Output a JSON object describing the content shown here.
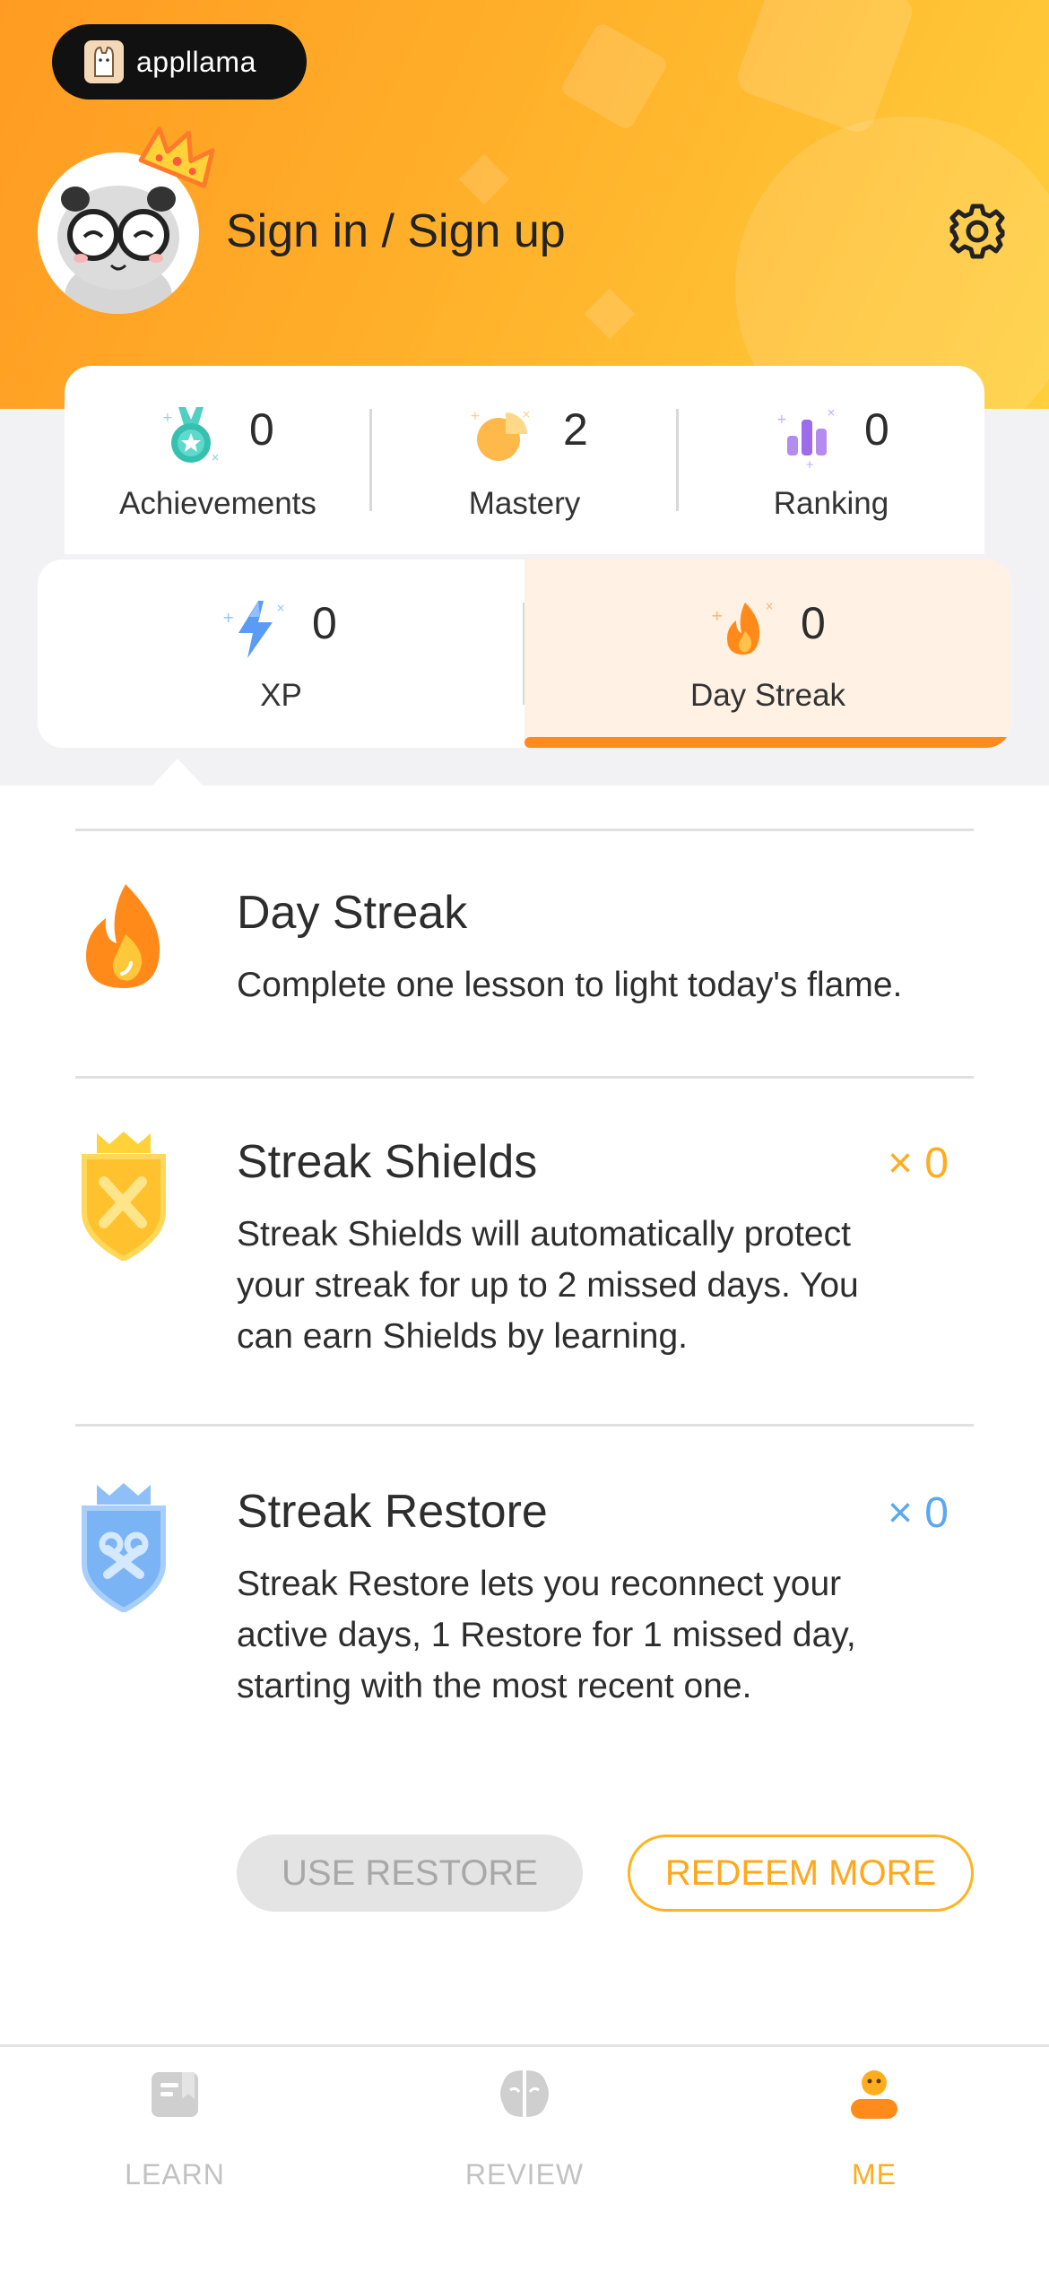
{
  "brand": {
    "badge_text": "appllama"
  },
  "profile": {
    "signin_label": "Sign in / Sign up"
  },
  "stats": [
    {
      "label": "Achievements",
      "value": "0",
      "icon": "medal-icon"
    },
    {
      "label": "Mastery",
      "value": "2",
      "icon": "pie-chart-icon"
    },
    {
      "label": "Ranking",
      "value": "0",
      "icon": "bar-ranking-icon"
    }
  ],
  "tabs": [
    {
      "label": "XP",
      "value": "0",
      "icon": "lightning-icon",
      "active": false
    },
    {
      "label": "Day Streak",
      "value": "0",
      "icon": "flame-icon",
      "active": true
    }
  ],
  "streak": {
    "title": "Day Streak",
    "desc": "Complete one lesson to light today's flame."
  },
  "shields": {
    "title": "Streak Shields",
    "count": "× 0",
    "desc_lines": [
      "Streak Shields will automatically protect",
      "your streak for up to 2 missed days. You",
      "can earn Shields by learning."
    ]
  },
  "restore": {
    "title": "Streak Restore",
    "count": "× 0",
    "desc_lines": [
      "Streak Restore lets you reconnect your",
      "active days, 1 Restore for 1 missed day,",
      "starting with the most recent one."
    ]
  },
  "buttons": {
    "use_restore": "USE RESTORE",
    "redeem_more": "REDEEM MORE"
  },
  "nav": [
    {
      "label": "LEARN",
      "icon": "book-icon",
      "active": false
    },
    {
      "label": "REVIEW",
      "icon": "brain-icon",
      "active": false
    },
    {
      "label": "ME",
      "icon": "profile-icon",
      "active": true
    }
  ],
  "colors": {
    "accent": "#ff8c1a",
    "gold": "#ffad1f",
    "blue": "#5aa8f0",
    "header_start": "#ff9b22",
    "header_end": "#ffcf3c"
  }
}
